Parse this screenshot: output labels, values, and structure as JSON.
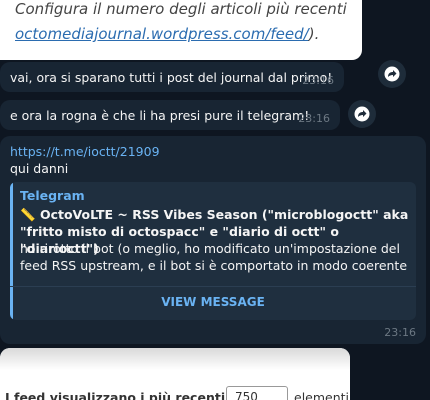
{
  "top_image": {
    "line1": "Configura il numero degli articoli più recenti",
    "line2": "octomediajournal.wordpress.com/feed/",
    "line2_suffix": ")."
  },
  "messages": [
    {
      "text": "vai, ora si sparano tutti i post del journal dal primo!",
      "time": "23:16",
      "forward_icon": "share-arrow-icon"
    },
    {
      "text": "e ora la rogna è che li ha presi pure il telegram!",
      "time": "23:16",
      "forward_icon": "share-arrow-icon"
    }
  ],
  "link_message": {
    "link": "https://t.me/ioctt/21909",
    "text": "qui danni",
    "time": "23:16",
    "preview": {
      "site": "Telegram",
      "emoji": "📏",
      "title": "OctoVoLTE ~ RSS Vibes Season (\"microblogoctt\" aka \"fritto misto di octospacc\" e \"diario di octt\" o \"diarioctt\")",
      "description": "ho rirotto il bot (o meglio, ho modificato un'impostazione del feed RSS upstream, e il bot si è comportato in modo coerente co...",
      "button": "VIEW MESSAGE"
    }
  },
  "bottom_image": {
    "label": "I feed visualizzano i più recenti",
    "value": "750",
    "unit": "elementi"
  },
  "colors": {
    "background": "#0e1621",
    "bubble": "#182533",
    "accent": "#6ab3f3",
    "time": "#6c7883"
  }
}
